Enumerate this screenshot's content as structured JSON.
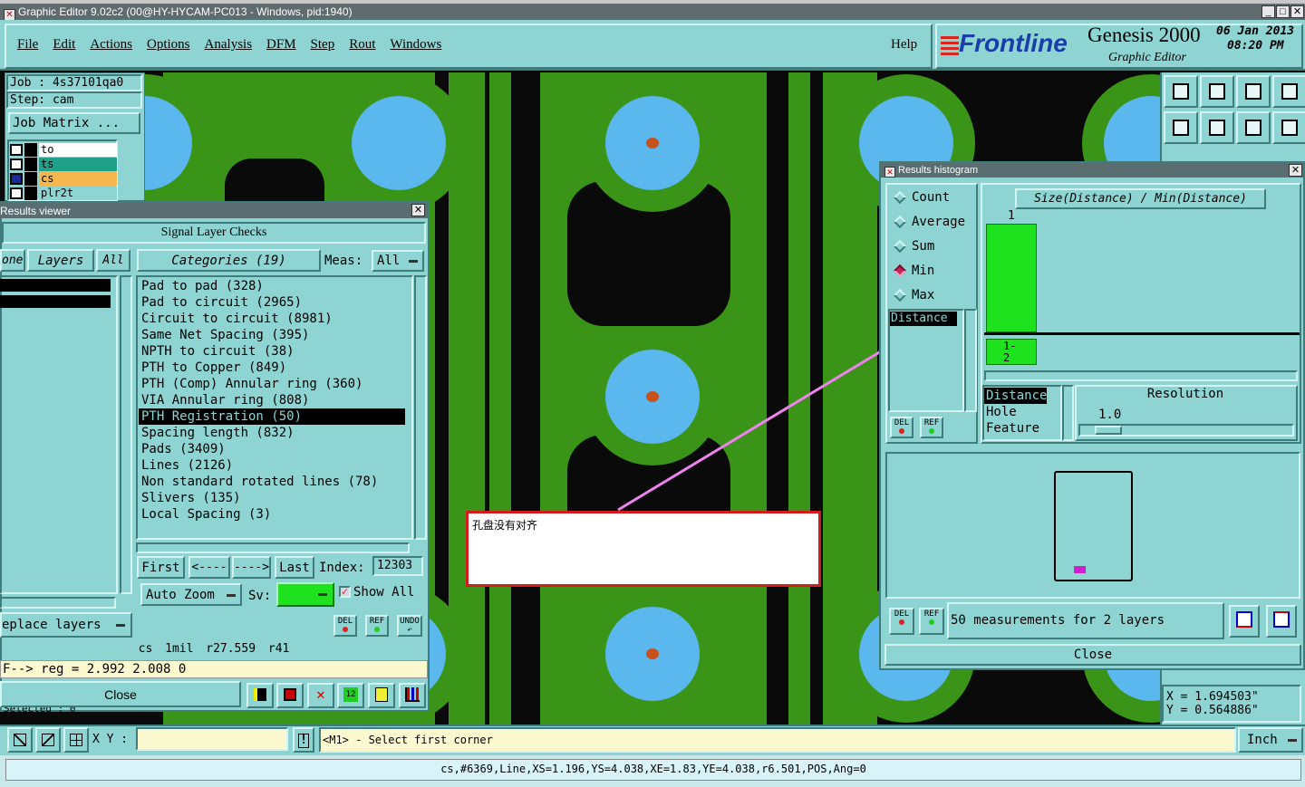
{
  "window": {
    "title": "Graphic Editor 9.02c2 (00@HY-HYCAM-PC013 - Windows, pid:1940)"
  },
  "menu": {
    "items": [
      "File",
      "Edit",
      "Actions",
      "Options",
      "Analysis",
      "DFM",
      "Step",
      "Rout",
      "Windows"
    ],
    "help": "Help"
  },
  "brand": {
    "logo": "Frontline",
    "product": "Genesis 2000",
    "subtitle": "Graphic Editor",
    "date": "06 Jan 2013",
    "time": "08:20 PM"
  },
  "job": {
    "job_line": "Job : 4s37101qa0",
    "step_line": "Step: cam",
    "matrix_button": "Job Matrix ..."
  },
  "layers": [
    {
      "name": "to",
      "color": "#ffffff"
    },
    {
      "name": "ts",
      "color": "#1fa08a"
    },
    {
      "name": "cs",
      "color": "#f6b84e"
    },
    {
      "name": "plr2t",
      "color": "#8ed4d2"
    }
  ],
  "results_viewer": {
    "title": "Results viewer",
    "header": "Signal Layer Checks",
    "one_tab": "one",
    "layers_tab": "Layers",
    "all_tab": "All",
    "categories_tab": "Categories (19)",
    "meas_label": "Meas:",
    "meas_value": "All",
    "categories": [
      "Pad to pad (328)",
      "Pad to circuit (2965)",
      "Circuit to circuit (8981)",
      "Same Net Spacing (395)",
      "NPTH to circuit (38)",
      "PTH to Copper (849)",
      "PTH (Comp) Annular ring (360)",
      "VIA Annular ring (808)",
      "PTH Registration (50)",
      "Spacing length (832)",
      "Pads (3409)",
      "Lines (2126)",
      "Non standard rotated lines (78)",
      "Slivers (135)",
      "Local Spacing (3)"
    ],
    "selected_index": 8,
    "nav": {
      "first": "First",
      "prev": "<----",
      "next": "---->",
      "last": "Last",
      "index_label": "Index:",
      "index_value": "12303"
    },
    "auto_zoom": "Auto Zoom",
    "sv_label": "Sv:",
    "show_all": "Show All",
    "replace_layers": "eplace layers",
    "del": "DEL",
    "ref": "REF",
    "undo": "UNDO",
    "status_line": "cs 1mil r27.559 r41",
    "reg_line": "F--> reg = 2.992 2.008 0",
    "close": "Close",
    "selected_partial": "Selected : 0"
  },
  "histogram": {
    "title": "Results histogram",
    "modes": [
      "Count",
      "Average",
      "Sum",
      "Min",
      "Max"
    ],
    "selected_mode": "Min",
    "list_item": "Distance",
    "chart_title": "Size(Distance) / Min(Distance)",
    "bar_count_label": "1",
    "bar_range_label": "1-\n2",
    "bar_fraction": 1.0,
    "param_options": [
      "Distance",
      "Hole",
      "Feature"
    ],
    "resolution_label": "Resolution",
    "resolution_value": "1.0",
    "measurements": "50 measurements for 2 layers",
    "close": "Close",
    "del": "DEL",
    "ref": "REF",
    "mini_label": "M1"
  },
  "annotation": {
    "text": "孔盘没有对齐"
  },
  "coords": {
    "x": "X = 1.694503\"",
    "y": "Y = 0.564886\""
  },
  "bottom": {
    "xy_label": "X Y :",
    "xy_value": "",
    "prompt": "<M1> - Select first corner",
    "units": "Inch"
  },
  "statusbar": {
    "text": "cs,#6369,Line,XS=1.196,YS=4.038,XE=1.83,YE=4.038,r6.501,POS,Ang=0"
  },
  "colors": {
    "teal": "#8ed4d2",
    "copper": "#3a9418",
    "pad_hole": "#5ab8ee",
    "drill": "#c8501a",
    "bar": "#1ee21e",
    "arrow": "#ee82ee"
  }
}
